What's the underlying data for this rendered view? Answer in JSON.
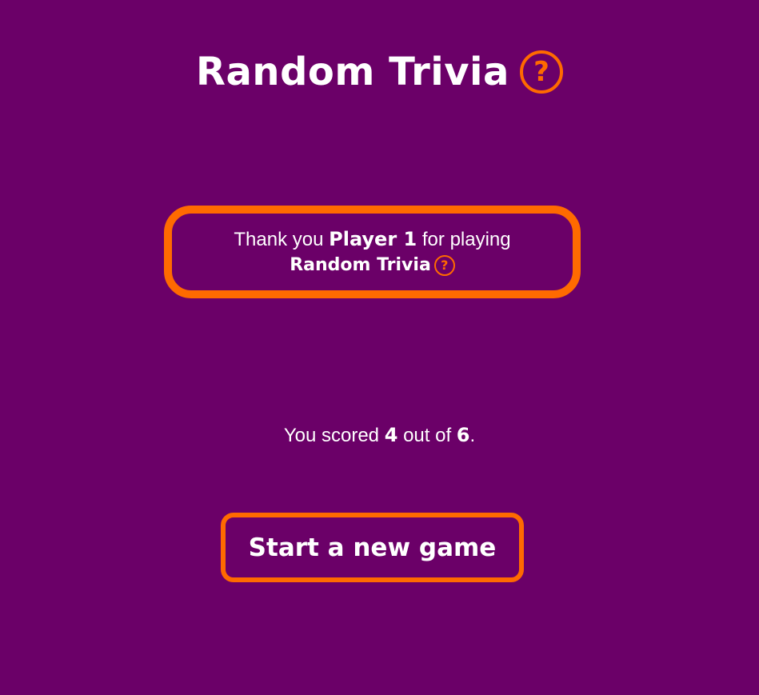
{
  "header": {
    "title": "Random Trivia",
    "icon_glyph": "?",
    "icon_name": "question-circle-icon"
  },
  "thanks": {
    "prefix": "Thank you",
    "player_name": "Player 1",
    "suffix": "for playing",
    "game_name": "Random Trivia",
    "icon_glyph": "?"
  },
  "score": {
    "prefix": "You scored",
    "value": "4",
    "middle": "out of",
    "total": "6",
    "end": "."
  },
  "actions": {
    "new_game_label": "Start a new game"
  },
  "colors": {
    "background": "#6b0068",
    "accent": "#ff6a00",
    "text": "#ffffff"
  }
}
